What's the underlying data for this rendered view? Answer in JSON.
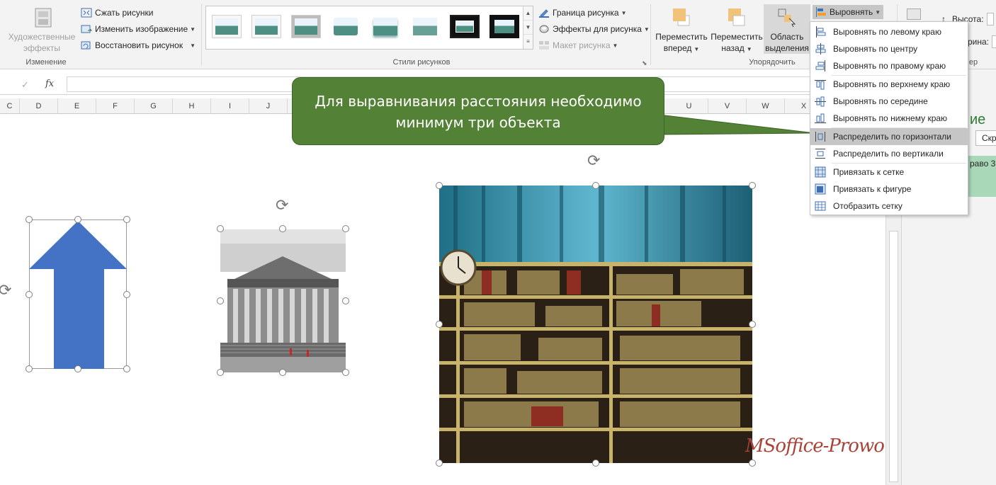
{
  "ribbon": {
    "change_group": {
      "artistic_effects": "Художественные эффекты",
      "compress": "Сжать рисунки",
      "change_picture": "Изменить изображение",
      "reset_picture": "Восстановить рисунок",
      "label": "Изменение"
    },
    "styles_group": {
      "label": "Стили рисунков",
      "border": "Граница рисунка",
      "effects": "Эффекты для рисунка",
      "layout": "Макет рисунка"
    },
    "arrange_group": {
      "bring_forward_1": "Переместить",
      "bring_forward_2": "вперед",
      "send_backward_1": "Переместить",
      "send_backward_2": "назад",
      "selection_pane_1": "Область",
      "selection_pane_2": "выделения",
      "align": "Выровнять",
      "label": "Упорядочить"
    },
    "size_group": {
      "height": "Высота:",
      "width": "рина:",
      "label": "ер"
    }
  },
  "formula_bar": {
    "fx": "fx",
    "cancel": "✓"
  },
  "columns": [
    "C",
    "D",
    "E",
    "F",
    "G",
    "H",
    "I",
    "J",
    "U",
    "V",
    "W",
    "X"
  ],
  "callout": {
    "line1": "Для выравнивания расстояния необходимо",
    "line2": "минимум три объекта"
  },
  "align_menu": [
    {
      "label": "Выровнять по левому краю"
    },
    {
      "label": "Выровнять по центру"
    },
    {
      "label": "Выровнять по правому краю"
    },
    {
      "label": "Выровнять по верхнему краю"
    },
    {
      "label": "Выровнять по середине"
    },
    {
      "label": "Выровнять по нижнему краю"
    },
    {
      "label": "Распределить по горизонтали"
    },
    {
      "label": "Распределить по вертикали"
    },
    {
      "label": "Привязать к сетке"
    },
    {
      "label": "Привязать к фигуре"
    },
    {
      "label": "Отобразить сетку"
    }
  ],
  "task_pane": {
    "title_fragment": "ие",
    "button_fragment": "Скр",
    "row_fragment": "раво 3"
  },
  "watermark": "MSoffice-Prowork.coM",
  "colors": {
    "arrow": "#4472c4",
    "callout": "#538135",
    "menu_highlight": "#c6c6c6"
  }
}
